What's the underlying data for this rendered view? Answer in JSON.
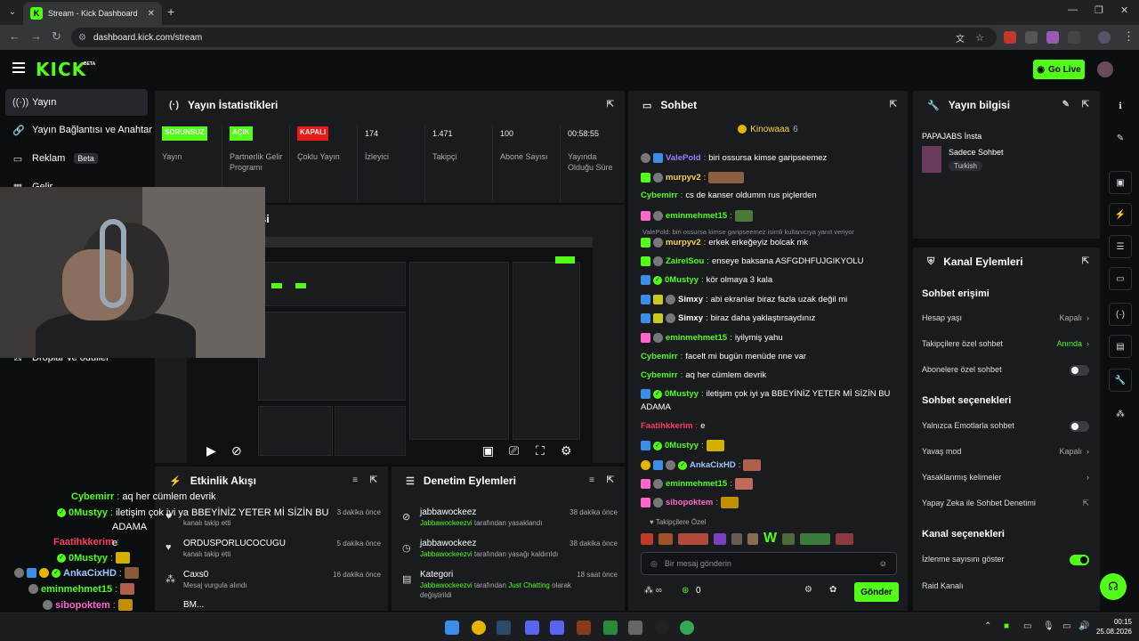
{
  "browser": {
    "tab_title": "Stream - Kick Dashboard",
    "url": "dashboard.kick.com/stream"
  },
  "kick": {
    "logo": "KICK",
    "beta": "BETA",
    "go_live": "Go Live"
  },
  "sidebar": {
    "items": [
      {
        "label": "Yayın",
        "icon": "broadcast-icon"
      },
      {
        "label": "Yayın Bağlantısı ve Anahtar",
        "icon": "link-icon"
      },
      {
        "label": "Reklam",
        "icon": "ad-icon",
        "badge": "Beta"
      },
      {
        "label": "Gelir",
        "icon": "money-icon"
      },
      {
        "label": "Droplar ve ödüller",
        "icon": "gift-icon"
      }
    ]
  },
  "stats_panel": {
    "title": "Yayın İstatistikleri",
    "stats": [
      {
        "value": "SORUNSUZ",
        "label": "Yayın",
        "tag": "green"
      },
      {
        "value": "AÇIK",
        "label": "Partnerlik Gelir Programı",
        "tag": "green"
      },
      {
        "value": "KAPALI",
        "label": "Çoklu Yayın",
        "tag": "red"
      },
      {
        "value": "174",
        "label": "İzleyici"
      },
      {
        "value": "1.471",
        "label": "Takipçi"
      },
      {
        "value": "100",
        "label": "Abone Sayısı"
      },
      {
        "value": "00:58:55",
        "label": "Yayında Olduğu Süre"
      }
    ]
  },
  "preview_panel": {
    "title_fragment": "esi"
  },
  "activity_panel": {
    "title": "Etkinlik Akışı",
    "items": [
      {
        "name": "",
        "desc": "kanalı takip etti",
        "time": "3 dakika önce",
        "icon": "heart-icon"
      },
      {
        "name": "ORDUSPORLUCOCUGU",
        "desc": "kanalı takip etti",
        "time": "5 dakika önce",
        "icon": "heart-icon"
      },
      {
        "name": "Caxs0",
        "desc": "Mesaj vurgula alındı",
        "time": "16 dakika önce",
        "icon": "kicks-icon"
      },
      {
        "name": "BM...",
        "desc": "",
        "time": "...",
        "icon": "heart-icon"
      }
    ]
  },
  "moderation_panel": {
    "title": "Denetim Eylemleri",
    "items": [
      {
        "name": "jabbawockeez",
        "actor": "Jabbawockeezvi",
        "desc": " tarafından yasaklandı",
        "time": "38 dakika önce",
        "icon": "ban-icon"
      },
      {
        "name": "jabbawockeez",
        "actor": "Jabbawockeezvi",
        "desc": " tarafından yasağı kaldırıldı",
        "time": "38 dakika önce",
        "icon": "clock-icon"
      },
      {
        "name": "Kategori",
        "actor": "Jabbawockeezvi",
        "desc": " tarafından ",
        "extra": "Just Chatting",
        "desc2": " olarak",
        "desc3": "değiştirildi",
        "time": "18 saat önce",
        "icon": "category-icon"
      }
    ]
  },
  "chat": {
    "title": "Sohbet",
    "pinned_user": "Kinowaaa",
    "pinned_count": "6",
    "messages": [
      {
        "user": "ValePold",
        "color": "#9b7bff",
        "text": "biri ossursa kimse garipseemez"
      },
      {
        "user": "murpyv2",
        "color": "#ffd24a",
        "text": ""
      },
      {
        "user": "Cybemirr",
        "color": "#53fc18",
        "text": "cs de kanser oldumm rus piçlerden"
      },
      {
        "user": "eminmehmet15",
        "color": "#53fc18",
        "text": ""
      },
      {
        "reply": "ValePold: biri ossursa kimse garipseemez isimli kullanıcıya yanıt veriyor"
      },
      {
        "user": "murpyv2",
        "color": "#ffd24a",
        "text": "erkek erkeğeyiz bolcak mk"
      },
      {
        "user": "ZairelSou",
        "color": "#53fc18",
        "text": "enseye baksana ASFGDHFUJGIKYOLU"
      },
      {
        "user": "0Mustyy",
        "color": "#53fc18",
        "text": "kör olmaya 3 kala"
      },
      {
        "user": "Simxy",
        "color": "#ffffff",
        "text": "abi ekranlar biraz fazla uzak değil mi"
      },
      {
        "user": "Simxy",
        "color": "#ffffff",
        "text": "biraz daha yaklaştırsaydınız"
      },
      {
        "user": "eminmehmet15",
        "color": "#53fc18",
        "text": "iyilymiş yahu"
      },
      {
        "user": "Cybemirr",
        "color": "#53fc18",
        "text": "facelt mi bugün menüde nne var"
      },
      {
        "user": "Cybemirr",
        "color": "#53fc18",
        "text": "aq her cümlem devrik"
      },
      {
        "user": "0Mustyy",
        "color": "#53fc18",
        "text": "iletişim çok iyi ya BBEYİNİZ YETER Mİ SİZİN BU"
      },
      {
        "continuation": "ADAMA"
      },
      {
        "user": "Faatihkkerim",
        "color": "#ff3b5c",
        "text": "e"
      },
      {
        "user": "0Mustyy",
        "color": "#53fc18",
        "text": ""
      },
      {
        "user": "AnkaCixHD",
        "color": "#9ec7ff",
        "text": ""
      },
      {
        "user": "eminmehmet15",
        "color": "#53fc18",
        "text": ""
      },
      {
        "user": "sibopoktem",
        "color": "#ff66cc",
        "text": ""
      }
    ],
    "followers_only": "Takipçilere Özel",
    "input_placeholder": "Bir mesaj gönderin",
    "kicks": "0",
    "send": "Gönder"
  },
  "stream_info": {
    "title": "Yayın bilgisi",
    "stream_title": "PAPAJABS İnsta",
    "category": "Sadece Sohbet",
    "language": "Turkish"
  },
  "channel_actions": {
    "title": "Kanal Eylemleri",
    "chat_access_title": "Sohbet erişimi",
    "account_age": {
      "label": "Hesap yaşı",
      "value": "Kapalı"
    },
    "followers_only": {
      "label": "Takipçilere özel sohbet",
      "value": "Anında"
    },
    "subs_only": {
      "label": "Abonelere özel sohbet"
    },
    "chat_options_title": "Sohbet seçenekleri",
    "emotes_only": {
      "label": "Yalnızca Emotlarla sohbet"
    },
    "slow_mode": {
      "label": "Yavaş mod",
      "value": "Kapalı"
    },
    "banned_words": {
      "label": "Yasaklanmış kelimeler"
    },
    "ai_moderation": {
      "label": "Yapay Zeka ile Sohbet Denetimi"
    },
    "channel_options_title": "Kanal seçenekleri",
    "show_viewers": {
      "label": "İzlenme sayısını göster"
    },
    "raid": {
      "label": "Raid Kanalı"
    }
  },
  "overlay_chat": [
    {
      "user": "Cybemirr",
      "color": "#53fc18",
      "text": "aq her cümlem devrik"
    },
    {
      "user": "0Mustyy",
      "color": "#53fc18",
      "text": "iletişim çok iyi ya BBEYİNİZ YETER Mİ SİZİN BU"
    },
    {
      "continuation": "ADAMA"
    },
    {
      "user": "Faatihkkerim",
      "color": "#ff3b5c",
      "text": "e"
    },
    {
      "user": "0Mustyy",
      "color": "#53fc18",
      "text": ""
    },
    {
      "user": "AnkaCixHD",
      "color": "#9ec7ff",
      "text": ""
    },
    {
      "user": "eminmehmet15",
      "color": "#53fc18",
      "text": ""
    },
    {
      "user": "sibopoktem",
      "color": "#ff66cc",
      "text": ""
    }
  ],
  "taskbar": {
    "time": "00:15",
    "date": "25.08.2026"
  }
}
